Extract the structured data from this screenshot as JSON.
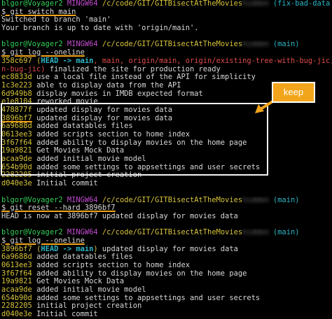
{
  "terminal": {
    "prompt_user": "blgor@Voyager2",
    "prompt_env": "MINGW64",
    "path": "/c/code/GIT/GITBisectAtTheMovies",
    "block1": {
      "cmd": "$ git switch main",
      "branch": "(fix-bad-data",
      "out1": "Switched to branch 'main'",
      "out2": "Your branch is up to date with 'origin/main'."
    },
    "block2": {
      "branch": "(main)",
      "cmd": "$ git log --oneline",
      "head_hash": "358c697",
      "head_refs": "HEAD -> main",
      "head_refs_rest": ", main, origin/main, origin/existing-tree-with-bug-jic, origi",
      "head_wrap": "n-bug-jic)",
      "head_msg": " finalized the site for production ready",
      "commits": [
        {
          "hash": "ec8833d",
          "msg": "use a local file instead of the API for simplicity"
        },
        {
          "hash": "1c3e223",
          "msg": "able to display data from the API"
        },
        {
          "hash": "6d949b8",
          "msg": "display movies in IMDB expected format"
        },
        {
          "hash": "e1e8104",
          "msg": "reworked movie"
        },
        {
          "hash": "478877f",
          "msg": "updated display for movies data"
        },
        {
          "hash": "3896bf7",
          "msg": "updated display for movies data"
        },
        {
          "hash": "6a9688d",
          "msg": "added datatables files"
        },
        {
          "hash": "0613ee3",
          "msg": "added scripts section to home index"
        },
        {
          "hash": "3f67f64",
          "msg": "added ability to display movies on the home page"
        },
        {
          "hash": "19a9821",
          "msg": "Get Movies Mock Data"
        },
        {
          "hash": "acaa9de",
          "msg": "added initial movie model"
        },
        {
          "hash": "654b90d",
          "msg": "added some settings to appsettings and user secrets"
        },
        {
          "hash": "2282205",
          "msg": "initial project creation"
        },
        {
          "hash": "d040e3e",
          "msg": "Initial commit"
        }
      ]
    },
    "block3": {
      "branch": "(main)",
      "cmd": "$ git reset --hard 3896bf7",
      "out": "HEAD is now at 3896bf7 updated display for movies data"
    },
    "block4": {
      "branch": "(main)",
      "cmd": "$ git log --oneline",
      "head_hash": "3896bf7",
      "head_refs": "HEAD -> main",
      "head_msg": " updated display for movies data",
      "commits": [
        {
          "hash": "6a9688d",
          "msg": "added datatables files"
        },
        {
          "hash": "0613ee3",
          "msg": "added scripts section to home index"
        },
        {
          "hash": "3f67f64",
          "msg": "added ability to display movies on the home page"
        },
        {
          "hash": "19a9821",
          "msg": "Get Movies Mock Data"
        },
        {
          "hash": "acaa9de",
          "msg": "added initial movie model"
        },
        {
          "hash": "654b90d",
          "msg": "added some settings to appsettings and user secrets"
        },
        {
          "hash": "2282205",
          "msg": "initial project creation"
        },
        {
          "hash": "d040e3e",
          "msg": "Initial commit"
        }
      ]
    }
  },
  "annotation": {
    "callout_label": "keep",
    "accent_color": "#f2a51a"
  }
}
